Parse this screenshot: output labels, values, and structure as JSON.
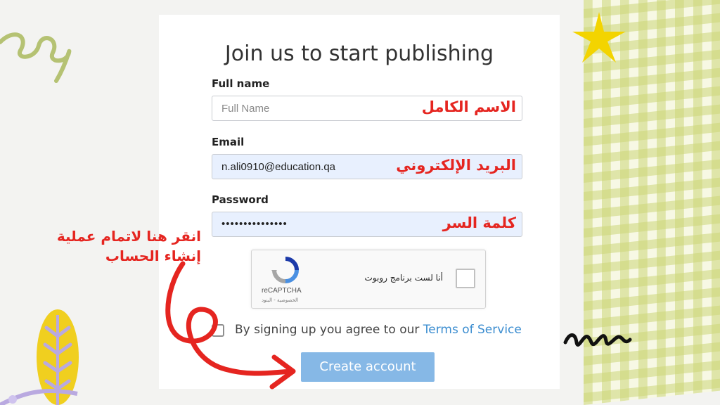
{
  "form": {
    "title": "Join us to start publishing",
    "full_name": {
      "label": "Full name",
      "placeholder": "Full Name",
      "annotation": "الاسم الكامل"
    },
    "email": {
      "label": "Email",
      "value": "n.ali0910@education.qa",
      "annotation": "البريد الإلكتروني"
    },
    "password": {
      "label": "Password",
      "value": "•••••••••••••••",
      "annotation": "كلمة السر"
    },
    "captcha": {
      "brand": "reCAPTCHA",
      "privacy": "الخصوصية - البنود",
      "prompt": "أنا لست برنامج روبوت"
    },
    "terms": {
      "text": "By signing up you agree to our ",
      "link": "Terms of Service"
    },
    "submit_label": "Create account"
  },
  "annotation": {
    "line1": "انقر هنا لاتمام عملية",
    "line2": "إنشاء الحساب"
  },
  "colors": {
    "annotation_red": "#e52520",
    "button_blue": "#86b8e6",
    "link_blue": "#3b8dd0",
    "checker_green": "#ccd678"
  }
}
